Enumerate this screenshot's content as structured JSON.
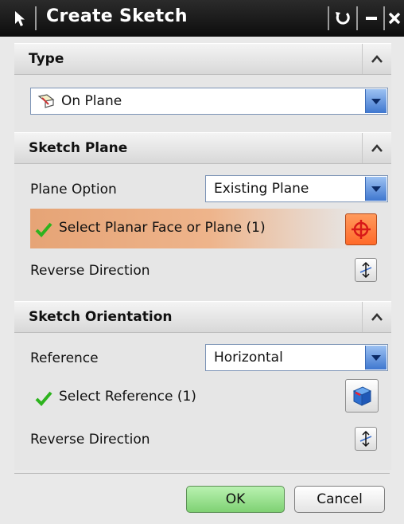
{
  "window": {
    "title": "Create Sketch"
  },
  "sections": {
    "type": {
      "header": "Type",
      "combo_value": "On Plane"
    },
    "sketch_plane": {
      "header": "Sketch Plane",
      "plane_option_label": "Plane Option",
      "plane_option_value": "Existing Plane",
      "select_label": "Select Planar Face or Plane (1)",
      "reverse_label": "Reverse Direction"
    },
    "sketch_orientation": {
      "header": "Sketch Orientation",
      "reference_label": "Reference",
      "reference_value": "Horizontal",
      "select_label": "Select Reference (1)",
      "reverse_label": "Reverse Direction"
    }
  },
  "footer": {
    "ok_label": "OK",
    "cancel_label": "Cancel"
  },
  "colors": {
    "title_bar": "#111111",
    "selection_band": "#eeb48b",
    "check_mark": "#2db31e",
    "combo_arrow": "#3f77cf",
    "ok_button": "#8fdb84",
    "crosshair": "#d81818"
  },
  "icons": {
    "title_left": "arrow-pointer-icon",
    "reset": "reset-icon",
    "minimize": "minimize-icon",
    "close": "close-icon",
    "collapse": "chevron-up-icon",
    "type_combo": "sketch-plane-icon",
    "select_face": "crosshair-icon",
    "reverse": "reverse-direction-icon",
    "select_reference": "cube-icon",
    "check": "check-icon"
  }
}
